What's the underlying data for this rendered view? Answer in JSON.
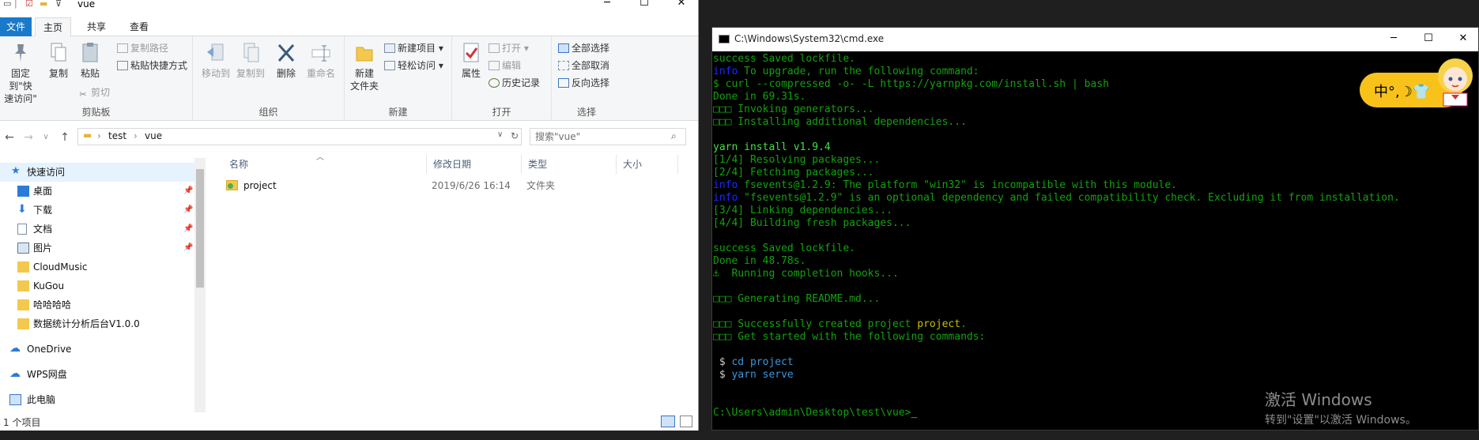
{
  "explorer": {
    "window_title": "vue",
    "ribbon_tabs": [
      "文件",
      "主页",
      "共享",
      "查看"
    ],
    "ribbon": {
      "clipboard": {
        "pin_label_1": "固定到\"快",
        "pin_label_2": "速访问\"",
        "copy": "复制",
        "paste": "粘贴",
        "copy_path": "复制路径",
        "paste_shortcut": "粘贴快捷方式",
        "cut": "剪切",
        "group": "剪贴板"
      },
      "organize": {
        "move_to": "移动到",
        "copy_to": "复制到",
        "delete": "删除",
        "rename": "重命名",
        "group": "组织"
      },
      "new": {
        "new_folder_1": "新建",
        "new_folder_2": "文件夹",
        "new_item": "新建项目",
        "easy_access": "轻松访问",
        "group": "新建"
      },
      "open": {
        "properties": "属性",
        "open": "打开",
        "edit": "编辑",
        "history": "历史记录",
        "group": "打开"
      },
      "select": {
        "select_all": "全部选择",
        "select_none": "全部取消",
        "invert": "反向选择",
        "group": "选择"
      }
    },
    "address": {
      "crumb_1": "test",
      "crumb_2": "vue",
      "search_placeholder": "搜索\"vue\""
    },
    "nav_pane": {
      "quick_access": "快速访问",
      "items": [
        {
          "label": "桌面",
          "pinned": true
        },
        {
          "label": "下载",
          "pinned": true
        },
        {
          "label": "文档",
          "pinned": true
        },
        {
          "label": "图片",
          "pinned": true
        },
        {
          "label": "CloudMusic",
          "pinned": false
        },
        {
          "label": "KuGou",
          "pinned": false
        },
        {
          "label": "哈哈哈哈",
          "pinned": false
        },
        {
          "label": "数据统计分析后台V1.0.0",
          "pinned": false
        }
      ],
      "onedrive": "OneDrive",
      "wps": "WPS网盘",
      "this_pc": "此电脑"
    },
    "columns": {
      "name": "名称",
      "date": "修改日期",
      "type": "类型",
      "size": "大小"
    },
    "files": [
      {
        "name": "project",
        "date": "2019/6/26 16:14",
        "type": "文件夹",
        "size": ""
      }
    ],
    "status": "1 个项目"
  },
  "cmd": {
    "title": "C:\\Windows\\System32\\cmd.exe",
    "lines": {
      "l1": "success Saved lockfile.",
      "l2a": "info",
      "l2b": " To upgrade, run the following command:",
      "l3": "$ curl --compressed -o- -L https://yarnpkg.com/install.sh | bash",
      "l4": "Done in 69.31s.",
      "l5": "□□□ Invoking generators...",
      "l6": "□□□ Installing additional dependencies...",
      "l7": "yarn install v1.9.4",
      "l8": "[1/4] Resolving packages...",
      "l9": "[2/4] Fetching packages...",
      "l10a": "info",
      "l10b": " fsevents@1.2.9: The platform \"win32\" is incompatible with this module.",
      "l11a": "info",
      "l11b": " \"fsevents@1.2.9\" is an optional dependency and failed compatibility check. Excluding it from installation.",
      "l12": "[3/4] Linking dependencies...",
      "l13": "[4/4] Building fresh packages...",
      "l14": "success Saved lockfile.",
      "l15": "Done in 48.78s.",
      "l16": "⚓  Running completion hooks...",
      "l17": "□□□ Generating README.md...",
      "l18a": "□□□ Successfully created project ",
      "l18b": "project",
      "l18c": ".",
      "l19": "□□□ Get started with the following commands:",
      "l20a": " $ ",
      "l20b": "cd project",
      "l21a": " $ ",
      "l21b": "yarn serve",
      "prompt": "C:\\Users\\admin\\Desktop\\test\\vue>"
    }
  },
  "ime": {
    "text": "中°,☽👕"
  },
  "activation": {
    "line1": "激活 Windows",
    "line2": "转到\"设置\"以激活 Windows。"
  },
  "colors": {
    "accent": "#1979ca",
    "cmd_green": "#13a10e",
    "cmd_blue": "#1a2bff",
    "cmd_cyan": "#3a96dd",
    "ime_yellow": "#f8c21a"
  }
}
